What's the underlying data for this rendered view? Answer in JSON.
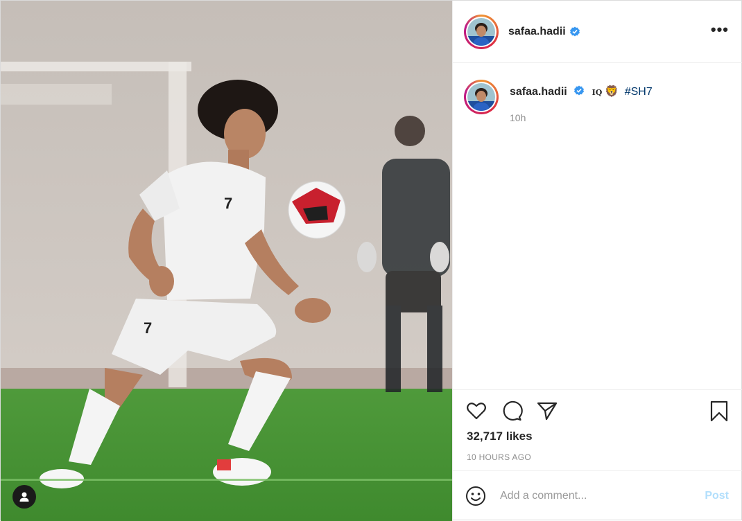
{
  "author": {
    "username": "safaa.hadii",
    "verified": true
  },
  "caption": {
    "flag_text": "IQ",
    "emoji": "🦁",
    "hashtag": "#SH7",
    "time": "10h"
  },
  "post": {
    "likes": "32,717 likes",
    "time": "10 HOURS AGO"
  },
  "comment": {
    "placeholder": "Add a comment...",
    "post_label": "Post"
  },
  "icons": {
    "more": "more-options-icon",
    "like": "heart-icon",
    "comment": "comment-icon",
    "share": "share-icon",
    "save": "bookmark-icon",
    "emoji": "emoji-icon",
    "user_tag": "user-tag-icon",
    "verified": "verified-badge-icon"
  },
  "colors": {
    "verified": "#3897f0",
    "hashtag": "#00376b",
    "post_disabled": "#b2dffc"
  }
}
